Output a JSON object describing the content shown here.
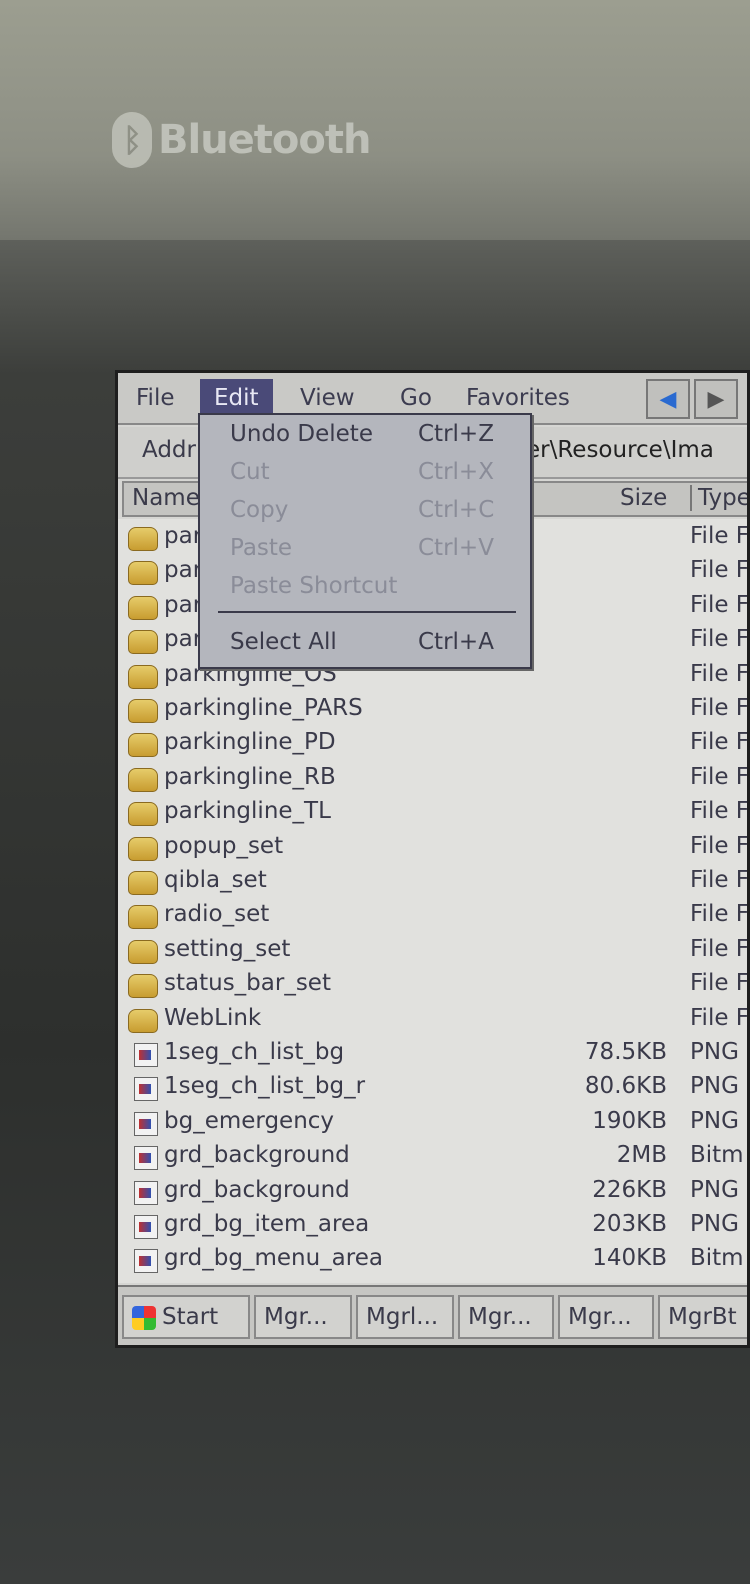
{
  "device": {
    "brand": "Bluetooth"
  },
  "menubar": {
    "items": [
      "File",
      "Edit",
      "View",
      "Go",
      "Favorites"
    ],
    "active": "Edit"
  },
  "address": {
    "label": "Addr",
    "path_visible": "er\\Resource\\Ima"
  },
  "columns": {
    "name": "Name",
    "size": "Size",
    "type": "Type"
  },
  "edit_menu": {
    "items": [
      {
        "label": "Undo Delete",
        "shortcut": "Ctrl+Z",
        "enabled": true
      },
      {
        "label": "Cut",
        "shortcut": "Ctrl+X",
        "enabled": false
      },
      {
        "label": "Copy",
        "shortcut": "Ctrl+C",
        "enabled": false
      },
      {
        "label": "Paste",
        "shortcut": "Ctrl+V",
        "enabled": false
      },
      {
        "label": "Paste Shortcut",
        "shortcut": "",
        "enabled": false
      },
      {
        "label": "Select All",
        "shortcut": "Ctrl+A",
        "enabled": true
      }
    ]
  },
  "files": [
    {
      "name": "par",
      "size": "",
      "type": "File F",
      "kind": "folder"
    },
    {
      "name": "par",
      "size": "",
      "type": "File F",
      "kind": "folder"
    },
    {
      "name": "par",
      "size": "",
      "type": "File F",
      "kind": "folder"
    },
    {
      "name": "par",
      "size": "",
      "type": "File F",
      "kind": "folder"
    },
    {
      "name": "parkingline_OS",
      "size": "",
      "type": "File F",
      "kind": "folder"
    },
    {
      "name": "parkingline_PARS",
      "size": "",
      "type": "File F",
      "kind": "folder"
    },
    {
      "name": "parkingline_PD",
      "size": "",
      "type": "File F",
      "kind": "folder"
    },
    {
      "name": "parkingline_RB",
      "size": "",
      "type": "File F",
      "kind": "folder"
    },
    {
      "name": "parkingline_TL",
      "size": "",
      "type": "File F",
      "kind": "folder"
    },
    {
      "name": "popup_set",
      "size": "",
      "type": "File F",
      "kind": "folder"
    },
    {
      "name": "qibla_set",
      "size": "",
      "type": "File F",
      "kind": "folder"
    },
    {
      "name": "radio_set",
      "size": "",
      "type": "File F",
      "kind": "folder"
    },
    {
      "name": "setting_set",
      "size": "",
      "type": "File F",
      "kind": "folder"
    },
    {
      "name": "status_bar_set",
      "size": "",
      "type": "File F",
      "kind": "folder"
    },
    {
      "name": "WebLink",
      "size": "",
      "type": "File F",
      "kind": "folder"
    },
    {
      "name": "1seg_ch_list_bg",
      "size": "78.5KB",
      "type": "PNG",
      "kind": "file"
    },
    {
      "name": "1seg_ch_list_bg_r",
      "size": "80.6KB",
      "type": "PNG",
      "kind": "file"
    },
    {
      "name": "bg_emergency",
      "size": "190KB",
      "type": "PNG",
      "kind": "file"
    },
    {
      "name": "grd_background",
      "size": "2MB",
      "type": "Bitm",
      "kind": "file"
    },
    {
      "name": "grd_background",
      "size": "226KB",
      "type": "PNG",
      "kind": "file"
    },
    {
      "name": "grd_bg_item_area",
      "size": "203KB",
      "type": "PNG",
      "kind": "file"
    },
    {
      "name": "grd_bg_menu_area",
      "size": "140KB",
      "type": "Bitm",
      "kind": "file"
    }
  ],
  "taskbar": {
    "start": "Start",
    "buttons": [
      "Mgr...",
      "Mgrl...",
      "Mgr...",
      "Mgr...",
      "MgrBt"
    ]
  }
}
